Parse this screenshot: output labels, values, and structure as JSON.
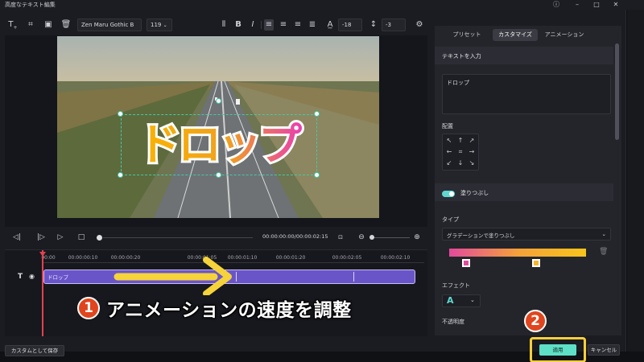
{
  "window": {
    "title": "高度なテキスト編集",
    "help_icon": "help-icon",
    "minimize_icon": "minimize-icon",
    "maximize_icon": "maximize-icon",
    "close_icon": "close-icon"
  },
  "toolbar": {
    "font_family": "Zen Maru Gothic B",
    "font_size": "119",
    "letter_spacing": "-18",
    "line_spacing": "-3",
    "bold_label": "B",
    "italic_label": "I"
  },
  "preview": {
    "text": "ドロップ",
    "text_fill_colors": [
      "#f9b400",
      "#f0a020",
      "#e93fb0"
    ],
    "outline_color": "#ffffff"
  },
  "playback": {
    "timecode": "00:00:00:00/00:00:02:15"
  },
  "timeline": {
    "ruler": [
      "00:00",
      "00:00:00:10",
      "00:00:00:20",
      "00:00:01:05",
      "00:00:01:10",
      "00:00:01:20",
      "00:00:02:05",
      "00:00:02:10"
    ],
    "track_icon": "T",
    "clip_label": "ドロップ",
    "clip_color": "#6a55c8"
  },
  "annotations": {
    "step1_number": "1",
    "step1_text": "アニメーションの速度を調整",
    "step2_number": "2",
    "arrow_color": "#f5d33a"
  },
  "panel": {
    "tabs": [
      {
        "label": "プリセット",
        "active": false
      },
      {
        "label": "カスタマイズ",
        "active": true
      },
      {
        "label": "アニメーション",
        "active": false
      }
    ],
    "text_input_section": "テキストを入力",
    "text_input_value": "ドロップ",
    "alignment_label": "配置",
    "fill_section": "塗りつぶし",
    "fill_enabled": true,
    "type_label": "タイプ",
    "type_value": "グラデーションで塗りつぶし",
    "gradient_colors": [
      "#e24a9c",
      "#f4a13a",
      "#f7c41c"
    ],
    "gradient_stop_colors": [
      "#e24a9c",
      "#f7b52a"
    ],
    "effect_label": "エフェクト",
    "effect_value": "A",
    "opacity_label": "不透明度"
  },
  "footer": {
    "save_custom": "カスタムとして保存",
    "apply": "適用",
    "cancel": "キャンセル"
  }
}
